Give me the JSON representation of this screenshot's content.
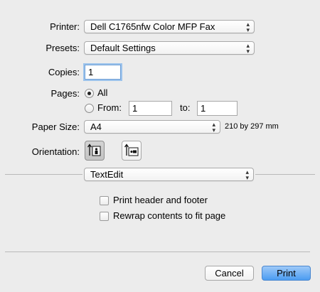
{
  "printer": {
    "label": "Printer:",
    "value": "Dell C1765nfw Color MFP Fax"
  },
  "presets": {
    "label": "Presets:",
    "value": "Default Settings"
  },
  "copies": {
    "label": "Copies:",
    "value": "1"
  },
  "pages": {
    "label": "Pages:",
    "all_label": "All",
    "from_label": "From:",
    "from_value": "1",
    "to_label": "to:",
    "to_value": "1",
    "selected": "All"
  },
  "paper_size": {
    "label": "Paper Size:",
    "value": "A4",
    "dimensions": "210 by 297 mm"
  },
  "orientation": {
    "label": "Orientation:",
    "options": [
      "portrait",
      "landscape"
    ],
    "selected": "portrait"
  },
  "section": {
    "value": "TextEdit"
  },
  "options": {
    "header_footer": {
      "label": "Print header and footer",
      "checked": false
    },
    "rewrap": {
      "label": "Rewrap contents to fit page",
      "checked": false
    }
  },
  "buttons": {
    "cancel": "Cancel",
    "print": "Print"
  },
  "icons": {
    "popup_arrows": "⌃⌄",
    "updown_arrows": "⇕"
  }
}
